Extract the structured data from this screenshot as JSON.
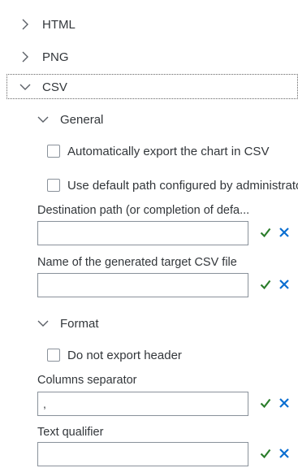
{
  "sections": {
    "html": {
      "label": "HTML"
    },
    "png": {
      "label": "PNG"
    },
    "csv": {
      "label": "CSV"
    }
  },
  "general": {
    "label": "General",
    "auto_export": "Automatically export the chart in CSV",
    "default_path": "Use default path configured by administrator"
  },
  "fields": {
    "destination_path": {
      "label": "Destination path (or completion of defa...",
      "value": ""
    },
    "target_name": {
      "label": "Name of the generated target CSV file",
      "value": ""
    }
  },
  "format": {
    "label": "Format",
    "no_header": "Do not export header",
    "columns_separator": {
      "label": "Columns separator",
      "value": ","
    },
    "text_qualifier": {
      "label": "Text qualifier",
      "value": ""
    }
  },
  "colors": {
    "accept": "#2b7d2b",
    "cancel": "#0a6ed1",
    "text": "#32363a",
    "border": "#89919a"
  },
  "icons": {
    "collapsed": "chevron-right-icon",
    "expanded": "chevron-down-icon",
    "accept": "check-icon",
    "cancel": "close-icon"
  }
}
